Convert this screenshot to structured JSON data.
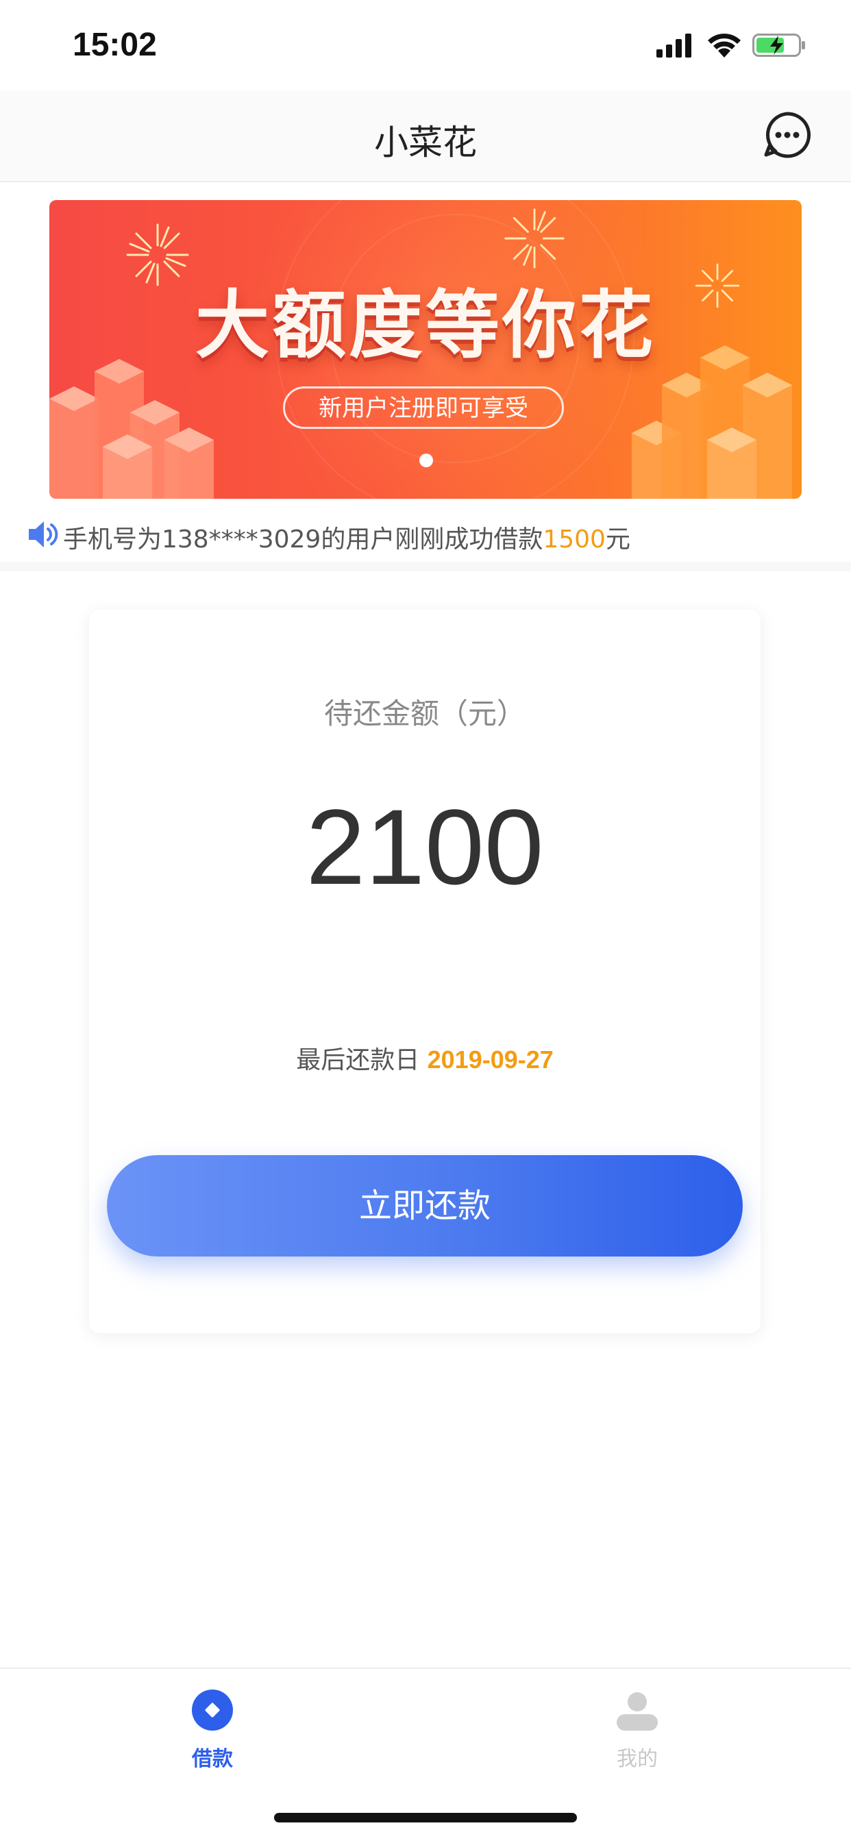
{
  "status_bar": {
    "time": "15:02",
    "icons": [
      "signal-icon",
      "wifi-icon",
      "battery-charging-icon"
    ]
  },
  "nav": {
    "title": "小菜花",
    "more_icon": "more-dots-icon"
  },
  "banner": {
    "title": "大额度等你花",
    "subtitle": "新用户注册即可享受",
    "page_indicator": {
      "pages": 1,
      "current": 1
    },
    "colors": {
      "start": "#f64a44",
      "end": "#fe8f1f"
    }
  },
  "notice": {
    "icon": "speaker-icon",
    "prefix": "手机号为138****3029的用户刚刚成功借款",
    "amount": "1500",
    "suffix": "元"
  },
  "card": {
    "label": "待还金额（元）",
    "amount": "2100",
    "due_label": "最后还款日 ",
    "due_date": "2019-09-27",
    "button_label": "立即还款"
  },
  "tab_bar": {
    "tabs": [
      {
        "label": "借款",
        "icon": "loan-diamond-icon",
        "active": true
      },
      {
        "label": "我的",
        "icon": "user-profile-icon",
        "active": false
      }
    ]
  },
  "colors": {
    "accent": "#2d5fea",
    "highlight": "#f39c12"
  }
}
